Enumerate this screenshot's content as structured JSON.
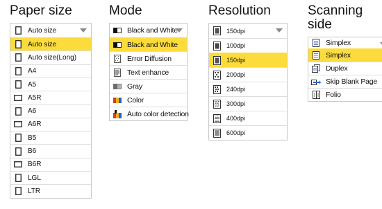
{
  "paper_size": {
    "title": "Paper size",
    "selected": "Auto size",
    "items": [
      {
        "label": "Auto size",
        "icon": "page-portrait-icon",
        "selected": true
      },
      {
        "label": "Auto size(Long)",
        "icon": "page-portrait-icon"
      },
      {
        "label": "A4",
        "icon": "page-portrait-icon"
      },
      {
        "label": "A5",
        "icon": "page-portrait-icon"
      },
      {
        "label": "A5R",
        "icon": "page-landscape-icon"
      },
      {
        "label": "A6",
        "icon": "page-portrait-icon"
      },
      {
        "label": "A6R",
        "icon": "page-landscape-icon"
      },
      {
        "label": "B5",
        "icon": "page-portrait-icon"
      },
      {
        "label": "B6",
        "icon": "page-portrait-icon"
      },
      {
        "label": "B6R",
        "icon": "page-landscape-icon"
      },
      {
        "label": "LGL",
        "icon": "page-portrait-icon"
      },
      {
        "label": "LTR",
        "icon": "page-portrait-icon"
      }
    ]
  },
  "mode": {
    "title": "Mode",
    "selected": "Black and White",
    "items": [
      {
        "label": "Black and White",
        "icon": "black-white-icon",
        "selected": true
      },
      {
        "label": "Error Diffusion",
        "icon": "error-diffusion-icon"
      },
      {
        "label": "Text enhance",
        "icon": "text-enhance-icon"
      },
      {
        "label": "Gray",
        "icon": "gray-icon"
      },
      {
        "label": "Color",
        "icon": "color-icon"
      },
      {
        "label": "Auto color detection",
        "icon": "auto-color-icon"
      }
    ]
  },
  "resolution": {
    "title": "Resolution",
    "selected": "150dpi",
    "items": [
      {
        "label": "100dpi",
        "icon": "dpi-100-icon"
      },
      {
        "label": "150dpi",
        "icon": "dpi-150-icon",
        "selected": true
      },
      {
        "label": "200dpi",
        "icon": "dpi-200-icon"
      },
      {
        "label": "240dpi",
        "icon": "dpi-240-icon"
      },
      {
        "label": "300dpi",
        "icon": "dpi-300-icon"
      },
      {
        "label": "400dpi",
        "icon": "dpi-400-icon"
      },
      {
        "label": "600dpi",
        "icon": "dpi-600-icon"
      }
    ]
  },
  "scanning_side": {
    "title_line1": "Scanning",
    "title_line2": "side",
    "selected": "Simplex",
    "items": [
      {
        "label": "Simplex",
        "icon": "simplex-icon",
        "selected": true
      },
      {
        "label": "Duplex",
        "icon": "duplex-icon"
      },
      {
        "label": "Skip Blank Page",
        "icon": "skip-blank-page-icon"
      },
      {
        "label": "Folio",
        "icon": "folio-icon"
      }
    ]
  },
  "colors": {
    "selection": "#fcdc3c",
    "border": "#c9c9c9",
    "arrow": "#8a8a8a"
  }
}
